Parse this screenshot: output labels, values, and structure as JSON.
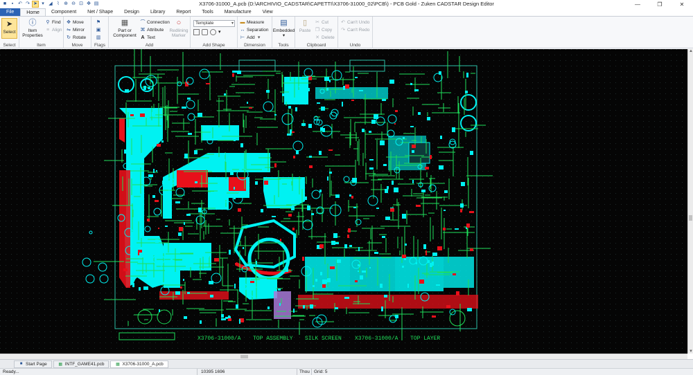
{
  "window": {
    "title": "X3706-31000_A.pcb (D:\\ARCHIVIO_CADSTAR\\CAPETTI\\X3706-31000_02\\PCB\\) - PCB Gold - Zuken CADSTAR Design Editor",
    "quick_access_icons": [
      "menu-icon",
      "save-icon",
      "undo-icon",
      "redo-icon",
      "pointer-icon",
      "chart-icon",
      "measure-icon",
      "zoom-in-icon",
      "zoom-out-icon",
      "zoom-fit-icon",
      "pan-icon",
      "props-icon",
      "dropdown-icon"
    ]
  },
  "ribbon_tabs": [
    "File",
    "Home",
    "Component",
    "Net / Shape",
    "Design",
    "Library",
    "Report",
    "Tools",
    "Manufacture",
    "View"
  ],
  "ribbon": {
    "select": {
      "label": "Select",
      "group": "Select"
    },
    "item": {
      "label_line1": "Item",
      "label_line2": "Properties",
      "find": "Find",
      "align": "Align",
      "group": "Item"
    },
    "move": {
      "move": "Move",
      "mirror": "Mirror",
      "rotate": "Rotate",
      "group": "Move"
    },
    "flags": {
      "group": "Flags"
    },
    "add": {
      "part_line1": "Part or",
      "part_line2": "Component",
      "connection": "Connection",
      "attribute": "Attribute",
      "text": "Text",
      "redline_line1": "Redlining",
      "redline_line2": "Marker",
      "group": "Add"
    },
    "add_shape": {
      "template": "Template",
      "group": "Add Shape"
    },
    "dimension": {
      "measure": "Measure",
      "separation": "Separation",
      "add": "Add",
      "group": "Dimension"
    },
    "tools": {
      "embedded": "Embedded",
      "group": "Tools"
    },
    "clipboard": {
      "paste": "Paste",
      "cut": "Cut",
      "copy": "Copy",
      "delete": "Delete",
      "group": "Clipboard"
    },
    "undo": {
      "cant_undo": "Can't Undo",
      "cant_redo": "Can't Redo",
      "group": "Undo"
    }
  },
  "board": {
    "silk_texts": [
      "X3706-31000/A",
      "TOP ASSEMBLY",
      "SILK SCREEN",
      "X3706-31000/A",
      "TOP LAYER"
    ],
    "colors": {
      "copper": "#00f2f2",
      "trace": "#1fe05a",
      "red_layer": "#e8101a",
      "outline": "#2bbfa6",
      "background": "#050505"
    }
  },
  "document_tabs": [
    "Start Page",
    "INTF_GAME41.pcb",
    "X3706-31000_A.pcb"
  ],
  "status": {
    "ready": "Ready...",
    "coordinates": "10395  1696",
    "units": "Thou",
    "grid": "Grid: 5"
  }
}
